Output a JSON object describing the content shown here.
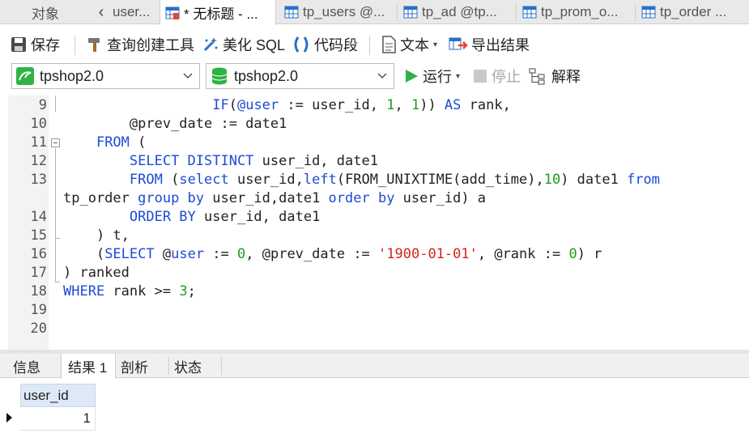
{
  "tabs": {
    "objects_label": "对象",
    "items": [
      {
        "label": "user..."
      },
      {
        "label": "* 无标题 - ..."
      },
      {
        "label": "tp_users @..."
      },
      {
        "label": "tp_ad @tp..."
      },
      {
        "label": "tp_prom_o..."
      },
      {
        "label": "tp_order ..."
      }
    ]
  },
  "toolbar": {
    "save": "保存",
    "query_builder": "查询创建工具",
    "beautify_sql": "美化 SQL",
    "code_snippet": "代码段",
    "text": "文本",
    "export_results": "导出结果",
    "run": "运行",
    "stop": "停止",
    "explain": "解释"
  },
  "connection_select": {
    "value": "tpshop2.0"
  },
  "database_select": {
    "value": "tpshop2.0"
  },
  "editor": {
    "line_numbers": [
      "9",
      "10",
      "11",
      "12",
      "13",
      "14",
      "15",
      "16",
      "17",
      "18",
      "19",
      "20"
    ],
    "lines": [
      [
        [
          "plain",
          "                  "
        ],
        [
          "kw",
          "IF"
        ],
        [
          "plain",
          "("
        ],
        [
          "var",
          "@user"
        ],
        [
          "plain",
          " := user_id, "
        ],
        [
          "num",
          "1"
        ],
        [
          "plain",
          ", "
        ],
        [
          "num",
          "1"
        ],
        [
          "plain",
          ")) "
        ],
        [
          "kw",
          "AS"
        ],
        [
          "plain",
          " rank,"
        ]
      ],
      [
        [
          "plain",
          "        "
        ],
        [
          "plain",
          "@prev_date := date1"
        ]
      ],
      [
        [
          "plain",
          "    "
        ],
        [
          "kw",
          "FROM"
        ],
        [
          "plain",
          " ("
        ]
      ],
      [
        [
          "plain",
          "        "
        ],
        [
          "kw",
          "SELECT DISTINCT"
        ],
        [
          "plain",
          " user_id, date1"
        ]
      ],
      [
        [
          "plain",
          "        "
        ],
        [
          "kw",
          "FROM"
        ],
        [
          "plain",
          " ("
        ],
        [
          "kw",
          "select"
        ],
        [
          "plain",
          " user_id,"
        ],
        [
          "kw",
          "left"
        ],
        [
          "plain",
          "(FROM_UNIXTIME(add_time),"
        ],
        [
          "num",
          "10"
        ],
        [
          "plain",
          ") date1 "
        ],
        [
          "kw",
          "from"
        ]
      ],
      [
        [
          "plain",
          "tp_order "
        ],
        [
          "kw",
          "group by"
        ],
        [
          "plain",
          " user_id,date1 "
        ],
        [
          "kw",
          "order by"
        ],
        [
          "plain",
          " user_id) a"
        ]
      ],
      [
        [
          "plain",
          "        "
        ],
        [
          "kw",
          "ORDER BY"
        ],
        [
          "plain",
          " user_id, date1"
        ]
      ],
      [
        [
          "plain",
          "    ) t,"
        ]
      ],
      [
        [
          "plain",
          "    ("
        ],
        [
          "kw",
          "SELECT"
        ],
        [
          "plain",
          " "
        ],
        [
          "plain",
          "@"
        ],
        [
          "var",
          "user"
        ],
        [
          "plain",
          " := "
        ],
        [
          "num",
          "0"
        ],
        [
          "plain",
          ", @prev_date := "
        ],
        [
          "str",
          "'1900-01-01'"
        ],
        [
          "plain",
          ", @rank := "
        ],
        [
          "num",
          "0"
        ],
        [
          "plain",
          ") r"
        ]
      ],
      [
        [
          "plain",
          ") ranked"
        ]
      ],
      [
        [
          "kw",
          "WHERE"
        ],
        [
          "plain",
          " rank >= "
        ],
        [
          "num",
          "3"
        ],
        [
          "plain",
          ";"
        ]
      ],
      [],
      []
    ]
  },
  "result_tabs": [
    "信息",
    "结果 1",
    "剖析",
    "状态"
  ],
  "result": {
    "columns": [
      "user_id"
    ],
    "rows": [
      [
        "1"
      ]
    ]
  },
  "colors": {
    "keyword": "#1d4bd6",
    "number": "#1a9e1a",
    "string": "#d2241f",
    "grid_header": "#dde9f7"
  }
}
